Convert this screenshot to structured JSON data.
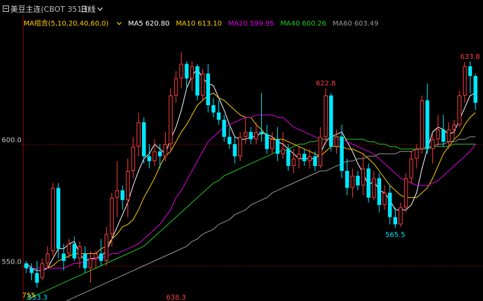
{
  "titlebar": {
    "icon": "minus-box-icon",
    "symbol_name": "美豆主连",
    "symbol_code": "(CBOT 3513)",
    "period": "日线",
    "period_icon": "chevron-down-icon"
  },
  "legend": {
    "group_label": "MA组合(5,10,20,40,60,0)",
    "items": [
      {
        "label": "MA5 620.80",
        "color": "#ffffff"
      },
      {
        "label": "MA10 613.10",
        "color": "#ffd000"
      },
      {
        "label": "MA20 599.95",
        "color": "#e000e0"
      },
      {
        "label": "MA40 600.26",
        "color": "#22cc22"
      },
      {
        "label": "MA60 603.49",
        "color": "#9a9a9a"
      }
    ]
  },
  "chart_data": {
    "type": "candlestick",
    "y_ticks": [
      "600.0",
      "550.0"
    ],
    "ylim": [
      535.5,
      653.0
    ],
    "colors": {
      "up": "#ff3c3c",
      "down": "#00e8ff",
      "grid": "#8a0000"
    },
    "annotations": [
      {
        "label": "638.3",
        "index": 28,
        "color": "#ff4040"
      },
      {
        "label": "622.8",
        "index": 56,
        "color": "#ff4040"
      },
      {
        "label": "565.5",
        "index": 69,
        "color": "#00e8ff"
      },
      {
        "label": "633.8",
        "index": 83,
        "color": "#ff4040"
      },
      {
        "label": "553.3",
        "index": 2,
        "color": "#00e8ff"
      },
      {
        "label": "755",
        "index": 0,
        "color": "#ffd000"
      }
    ],
    "candles": [
      {
        "o": 551,
        "h": 552,
        "l": 547,
        "c": 549
      },
      {
        "o": 549,
        "h": 551,
        "l": 544,
        "c": 547
      },
      {
        "o": 547,
        "h": 552,
        "l": 541,
        "c": 543
      },
      {
        "o": 545,
        "h": 553,
        "l": 544,
        "c": 551
      },
      {
        "o": 551,
        "h": 558,
        "l": 549,
        "c": 555
      },
      {
        "o": 556,
        "h": 584,
        "l": 554,
        "c": 582
      },
      {
        "o": 582,
        "h": 584,
        "l": 553,
        "c": 557
      },
      {
        "o": 555,
        "h": 559,
        "l": 548,
        "c": 552
      },
      {
        "o": 555,
        "h": 561,
        "l": 553,
        "c": 559
      },
      {
        "o": 559,
        "h": 562,
        "l": 552,
        "c": 553
      },
      {
        "o": 553,
        "h": 560,
        "l": 549,
        "c": 558
      },
      {
        "o": 555,
        "h": 558,
        "l": 547,
        "c": 549
      },
      {
        "o": 549,
        "h": 556,
        "l": 543,
        "c": 553
      },
      {
        "o": 553,
        "h": 556,
        "l": 549,
        "c": 555
      },
      {
        "o": 555,
        "h": 561,
        "l": 550,
        "c": 552
      },
      {
        "o": 552,
        "h": 566,
        "l": 550,
        "c": 563
      },
      {
        "o": 563,
        "h": 580,
        "l": 558,
        "c": 578
      },
      {
        "o": 578,
        "h": 593,
        "l": 570,
        "c": 581
      },
      {
        "o": 581,
        "h": 583,
        "l": 573,
        "c": 577
      },
      {
        "o": 577,
        "h": 594,
        "l": 570,
        "c": 589
      },
      {
        "o": 589,
        "h": 603,
        "l": 586,
        "c": 599
      },
      {
        "o": 599,
        "h": 613,
        "l": 595,
        "c": 609
      },
      {
        "o": 609,
        "h": 611,
        "l": 592,
        "c": 595
      },
      {
        "o": 595,
        "h": 600,
        "l": 590,
        "c": 593
      },
      {
        "o": 593,
        "h": 602,
        "l": 591,
        "c": 597
      },
      {
        "o": 597,
        "h": 600,
        "l": 590,
        "c": 595
      },
      {
        "o": 595,
        "h": 605,
        "l": 593,
        "c": 600
      },
      {
        "o": 600,
        "h": 623,
        "l": 597,
        "c": 620
      },
      {
        "o": 620,
        "h": 630,
        "l": 617,
        "c": 627
      },
      {
        "o": 627,
        "h": 638,
        "l": 623,
        "c": 633
      },
      {
        "o": 633,
        "h": 634,
        "l": 623,
        "c": 627
      },
      {
        "o": 627,
        "h": 634,
        "l": 622,
        "c": 632
      },
      {
        "o": 632,
        "h": 633,
        "l": 618,
        "c": 620
      },
      {
        "o": 620,
        "h": 631,
        "l": 618,
        "c": 629
      },
      {
        "o": 629,
        "h": 633,
        "l": 613,
        "c": 616
      },
      {
        "o": 616,
        "h": 619,
        "l": 611,
        "c": 613
      },
      {
        "o": 613,
        "h": 618,
        "l": 608,
        "c": 610
      },
      {
        "o": 610,
        "h": 612,
        "l": 601,
        "c": 603
      },
      {
        "o": 603,
        "h": 607,
        "l": 598,
        "c": 600
      },
      {
        "o": 600,
        "h": 603,
        "l": 592,
        "c": 595
      },
      {
        "o": 595,
        "h": 605,
        "l": 593,
        "c": 603
      },
      {
        "o": 603,
        "h": 611,
        "l": 600,
        "c": 605
      },
      {
        "o": 605,
        "h": 607,
        "l": 600,
        "c": 602
      },
      {
        "o": 602,
        "h": 609,
        "l": 600,
        "c": 605
      },
      {
        "o": 605,
        "h": 621,
        "l": 601,
        "c": 604
      },
      {
        "o": 604,
        "h": 608,
        "l": 596,
        "c": 598
      },
      {
        "o": 598,
        "h": 605,
        "l": 596,
        "c": 602
      },
      {
        "o": 602,
        "h": 607,
        "l": 593,
        "c": 596
      },
      {
        "o": 596,
        "h": 605,
        "l": 594,
        "c": 598
      },
      {
        "o": 598,
        "h": 600,
        "l": 589,
        "c": 591
      },
      {
        "o": 591,
        "h": 598,
        "l": 588,
        "c": 594
      },
      {
        "o": 594,
        "h": 599,
        "l": 590,
        "c": 596
      },
      {
        "o": 596,
        "h": 598,
        "l": 591,
        "c": 593
      },
      {
        "o": 593,
        "h": 598,
        "l": 590,
        "c": 595
      },
      {
        "o": 595,
        "h": 597,
        "l": 589,
        "c": 591
      },
      {
        "o": 591,
        "h": 607,
        "l": 590,
        "c": 603
      },
      {
        "o": 603,
        "h": 623,
        "l": 600,
        "c": 620
      },
      {
        "o": 620,
        "h": 621,
        "l": 597,
        "c": 599
      },
      {
        "o": 599,
        "h": 606,
        "l": 596,
        "c": 603
      },
      {
        "o": 603,
        "h": 608,
        "l": 586,
        "c": 589
      },
      {
        "o": 589,
        "h": 594,
        "l": 579,
        "c": 582
      },
      {
        "o": 582,
        "h": 590,
        "l": 578,
        "c": 587
      },
      {
        "o": 587,
        "h": 589,
        "l": 581,
        "c": 583
      },
      {
        "o": 583,
        "h": 596,
        "l": 579,
        "c": 590
      },
      {
        "o": 590,
        "h": 592,
        "l": 576,
        "c": 578
      },
      {
        "o": 578,
        "h": 589,
        "l": 577,
        "c": 586
      },
      {
        "o": 586,
        "h": 588,
        "l": 572,
        "c": 575
      },
      {
        "o": 575,
        "h": 583,
        "l": 573,
        "c": 580
      },
      {
        "o": 580,
        "h": 583,
        "l": 567,
        "c": 570
      },
      {
        "o": 570,
        "h": 574,
        "l": 565.5,
        "c": 567
      },
      {
        "o": 567,
        "h": 576,
        "l": 566,
        "c": 574
      },
      {
        "o": 574,
        "h": 588,
        "l": 572,
        "c": 586
      },
      {
        "o": 586,
        "h": 597,
        "l": 584,
        "c": 594
      },
      {
        "o": 594,
        "h": 600,
        "l": 590,
        "c": 598
      },
      {
        "o": 598,
        "h": 620,
        "l": 596,
        "c": 618
      },
      {
        "o": 618,
        "h": 625,
        "l": 596,
        "c": 598
      },
      {
        "o": 598,
        "h": 604,
        "l": 592,
        "c": 602
      },
      {
        "o": 602,
        "h": 612,
        "l": 599,
        "c": 606
      },
      {
        "o": 606,
        "h": 612,
        "l": 599,
        "c": 601
      },
      {
        "o": 601,
        "h": 609,
        "l": 598,
        "c": 606
      },
      {
        "o": 606,
        "h": 610,
        "l": 602,
        "c": 608
      },
      {
        "o": 608,
        "h": 622,
        "l": 607,
        "c": 620
      },
      {
        "o": 620,
        "h": 633.8,
        "l": 617,
        "c": 632
      },
      {
        "o": 632,
        "h": 634,
        "l": 621,
        "c": 628
      },
      {
        "o": 628,
        "h": 629,
        "l": 614,
        "c": 617
      }
    ],
    "ma": [
      {
        "name": "MA5",
        "color": "#ffffff",
        "values": [
          551,
          549,
          548,
          548,
          549,
          553,
          557,
          557,
          559,
          560,
          555,
          552,
          553,
          553,
          554,
          556,
          561,
          566,
          571,
          576,
          583,
          589,
          594,
          596,
          600,
          598,
          596,
          602,
          607,
          614,
          623,
          628,
          631,
          627,
          625,
          624,
          619,
          614,
          608,
          603,
          602,
          602,
          603,
          603,
          605,
          604,
          603,
          601,
          600,
          598,
          596,
          594,
          594,
          594,
          594,
          596,
          601,
          603,
          604,
          605,
          601,
          597,
          592,
          588,
          583,
          585,
          581,
          580,
          577,
          573,
          573,
          573,
          575,
          580,
          590,
          598,
          605,
          607,
          606,
          604,
          605,
          610,
          615,
          620,
          621
        ]
      },
      {
        "name": "MA10",
        "color": "#ffd000",
        "values": [
          549,
          549,
          549,
          549,
          549,
          550,
          552,
          553,
          554,
          555,
          555,
          555,
          555,
          555,
          557,
          558,
          561,
          563,
          566,
          567,
          569,
          573,
          578,
          582,
          586,
          591,
          595,
          597,
          601,
          605,
          608,
          612,
          616,
          618,
          620,
          621,
          619,
          618,
          616,
          614,
          612,
          611,
          611,
          608,
          606,
          603,
          602,
          602,
          602,
          601,
          600,
          599,
          598,
          597,
          596,
          595,
          597,
          599,
          599,
          599,
          598,
          598,
          597,
          596,
          594,
          592,
          589,
          586,
          583,
          581,
          579,
          578,
          578,
          578,
          580,
          582,
          586,
          591,
          596,
          599,
          602,
          604,
          608,
          611,
          613
        ]
      },
      {
        "name": "MA20",
        "color": "#e000e0",
        "values": [
          549,
          549,
          549,
          549,
          549,
          549,
          549,
          549,
          550,
          551,
          551,
          552,
          552,
          553,
          553,
          554,
          555,
          555,
          556,
          557,
          558,
          559,
          561,
          563,
          565,
          567,
          570,
          573,
          578,
          581,
          585,
          589,
          593,
          597,
          601,
          603,
          605,
          607,
          608,
          609,
          610,
          611,
          611,
          612,
          612,
          612,
          612,
          611,
          611,
          609,
          607,
          606,
          605,
          604,
          603,
          602,
          602,
          602,
          602,
          602,
          601,
          600,
          599,
          598,
          597,
          596,
          594,
          592,
          590,
          588,
          586,
          585,
          584,
          583,
          583,
          583,
          584,
          585,
          587,
          589,
          591,
          593,
          595,
          597,
          600
        ]
      },
      {
        "name": "MA40",
        "color": "#22cc22",
        "values": [
          536,
          537,
          538,
          539,
          540,
          541,
          542,
          543,
          544,
          545,
          546,
          547,
          548,
          549,
          550,
          551,
          552,
          553,
          554,
          555,
          556,
          557,
          558,
          560,
          562,
          564,
          566,
          568,
          570,
          572,
          574,
          576,
          578,
          580,
          582,
          584,
          585,
          587,
          588,
          589,
          590,
          591,
          592,
          593,
          594,
          595,
          596,
          597,
          597,
          598,
          599,
          600,
          600,
          601,
          601,
          602,
          602,
          603,
          603,
          603,
          602,
          602,
          602,
          602,
          601,
          601,
          600,
          600,
          599,
          599,
          598,
          598,
          598,
          598,
          598,
          598,
          599,
          599,
          599,
          599,
          600,
          600,
          600,
          600,
          600
        ]
      },
      {
        "name": "MA60",
        "color": "#9a9a9a",
        "values": [
          530,
          531,
          532,
          532,
          533,
          534,
          535,
          535,
          536,
          537,
          538,
          539,
          540,
          541,
          542,
          543,
          544,
          545,
          546,
          547,
          548,
          549,
          550,
          551,
          552,
          553,
          554,
          555,
          556,
          557,
          558,
          560,
          561,
          563,
          564,
          565,
          567,
          568,
          569,
          571,
          572,
          573,
          575,
          576,
          577,
          578,
          580,
          581,
          582,
          583,
          584,
          585,
          586,
          587,
          588,
          589,
          589,
          590,
          591,
          592,
          593,
          593,
          594,
          594,
          595,
          595,
          596,
          596,
          596,
          596,
          597,
          597,
          597,
          598,
          598,
          599,
          599,
          600,
          600,
          601,
          601,
          602,
          602,
          603,
          603
        ]
      }
    ]
  }
}
